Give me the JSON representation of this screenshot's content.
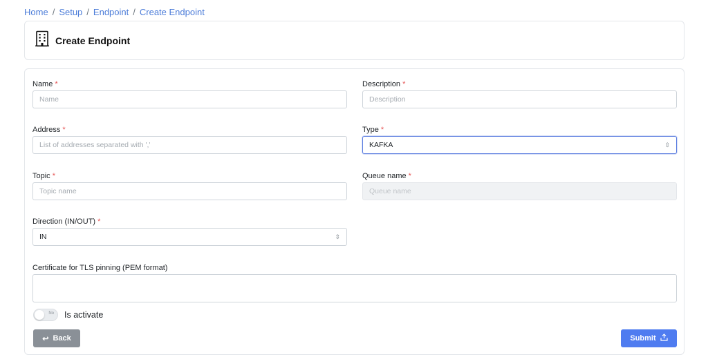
{
  "breadcrumb": [
    {
      "label": "Home"
    },
    {
      "label": "Setup"
    },
    {
      "label": "Endpoint"
    },
    {
      "label": "Create Endpoint"
    }
  ],
  "header": {
    "title": "Create Endpoint",
    "icon": "building-icon"
  },
  "form": {
    "name": {
      "label": "Name",
      "required": "*",
      "placeholder": "Name"
    },
    "description": {
      "label": "Description",
      "required": "*",
      "placeholder": "Description"
    },
    "address": {
      "label": "Address",
      "required": "*",
      "placeholder": "List of addresses separated with ','"
    },
    "type": {
      "label": "Type",
      "required": "*",
      "value": "KAFKA"
    },
    "topic": {
      "label": "Topic",
      "required": "*",
      "placeholder": "Topic name"
    },
    "queue_name": {
      "label": "Queue name",
      "required": "*",
      "placeholder": "Queue name"
    },
    "direction": {
      "label": "Direction (IN/OUT)",
      "required": "*",
      "value": "IN"
    },
    "certificate": {
      "label": "Certificate for TLS pinning (PEM format)"
    },
    "activate": {
      "label": "Is activate",
      "toggle_text": "No"
    }
  },
  "buttons": {
    "back": "Back",
    "submit": "Submit"
  }
}
